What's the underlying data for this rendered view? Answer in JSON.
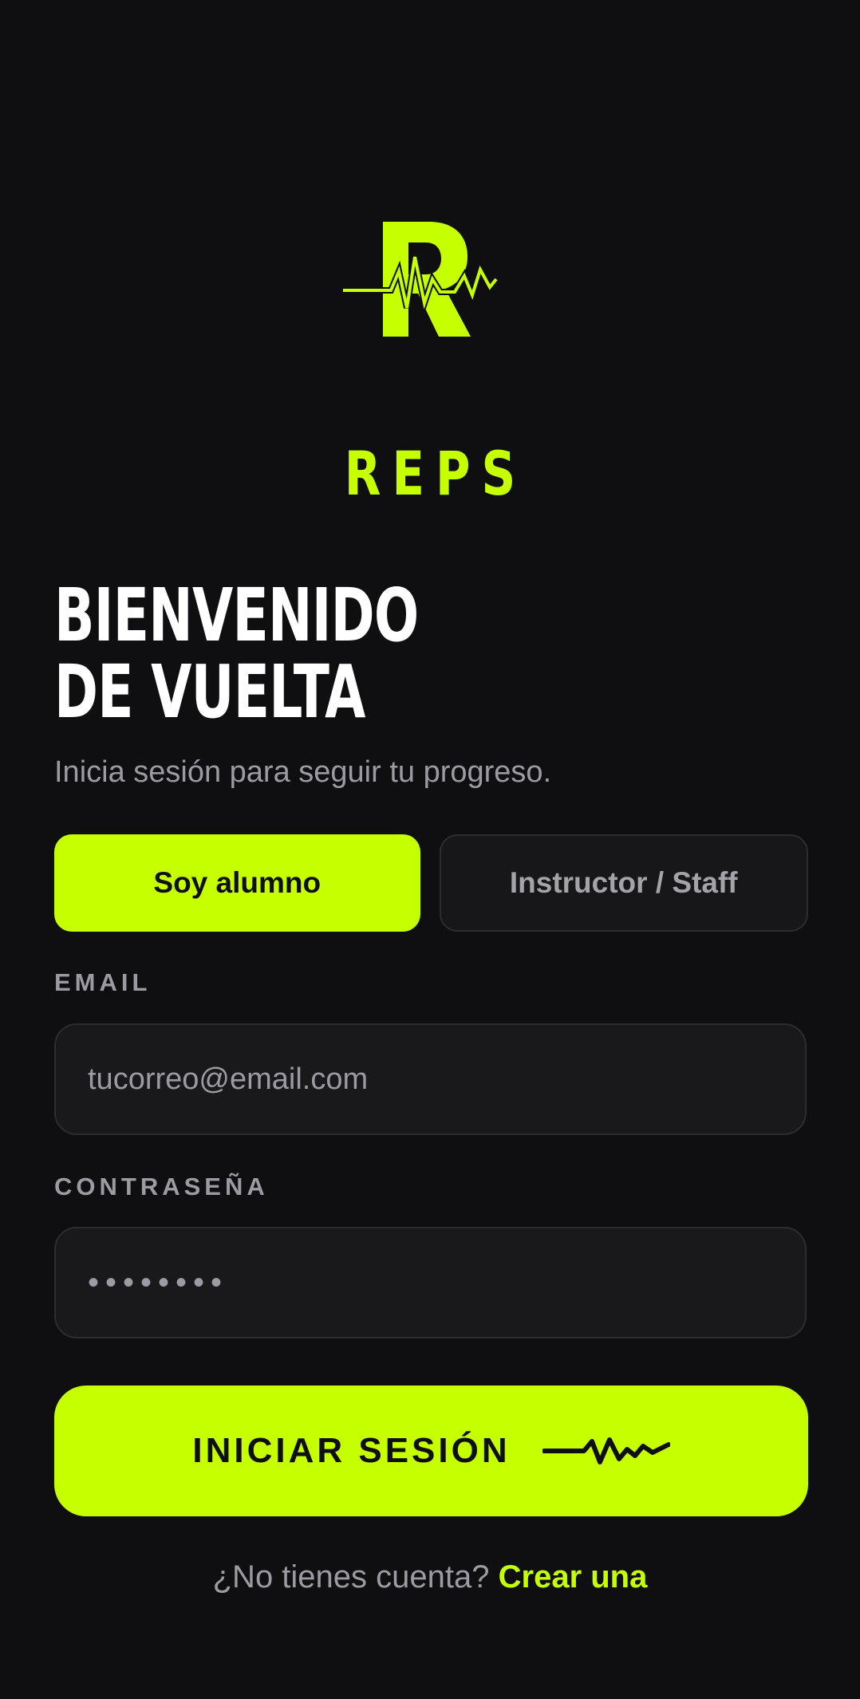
{
  "brand": {
    "logo_icon": "reps-r-pulse-logo-icon",
    "name": "REPS",
    "accent_color": "#c6ff00"
  },
  "welcome": {
    "line1": "BIENVENIDO",
    "line2": "DE VUELTA",
    "subtitle": "Inicia sesión para seguir tu progreso."
  },
  "roles": {
    "student_label": "Soy alumno",
    "staff_label": "Instructor / Staff",
    "selected": "student"
  },
  "form": {
    "email_label": "EMAIL",
    "email_placeholder": "tucorreo@email.com",
    "password_label": "CONTRASEÑA",
    "password_value": "••••••••"
  },
  "login": {
    "label": "INICIAR SESIÓN",
    "icon": "pulse-icon"
  },
  "signup": {
    "question": "¿No tienes cuenta?",
    "link": "Crear una"
  }
}
